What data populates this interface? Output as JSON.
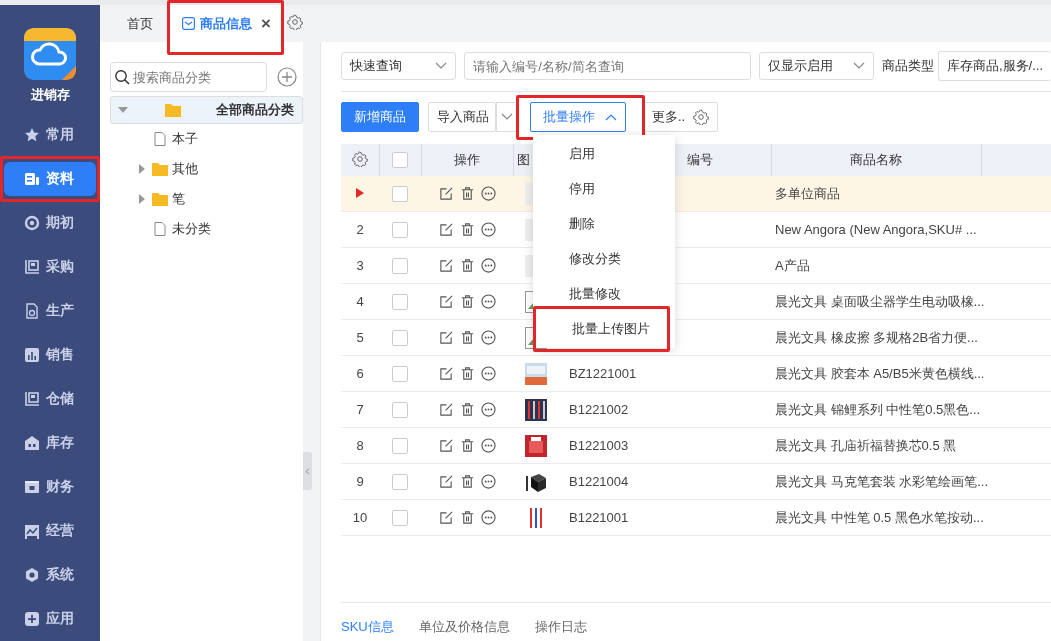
{
  "app": {
    "name": "进销存"
  },
  "nav": [
    {
      "label": "常用",
      "selected": false,
      "highlighted": false
    },
    {
      "label": "资料",
      "selected": true,
      "highlighted": true
    },
    {
      "label": "期初",
      "selected": false,
      "highlighted": false
    },
    {
      "label": "采购",
      "selected": false,
      "highlighted": false
    },
    {
      "label": "生产",
      "selected": false,
      "highlighted": false
    },
    {
      "label": "销售",
      "selected": false,
      "highlighted": false
    },
    {
      "label": "仓储",
      "selected": false,
      "highlighted": false
    },
    {
      "label": "库存",
      "selected": false,
      "highlighted": false
    },
    {
      "label": "财务",
      "selected": false,
      "highlighted": false
    },
    {
      "label": "经营",
      "selected": false,
      "highlighted": false
    },
    {
      "label": "系统",
      "selected": false,
      "highlighted": false
    },
    {
      "label": "应用",
      "selected": false,
      "highlighted": false
    }
  ],
  "tabs": [
    {
      "label": "首页",
      "selected": false,
      "closable": false,
      "highlighted": false
    },
    {
      "label": "商品信息",
      "selected": true,
      "closable": true,
      "highlighted": true
    }
  ],
  "tab_close": "×",
  "tree": {
    "search_placeholder": "搜索商品分类",
    "items": [
      {
        "label": "全部商品分类",
        "kind": "folder",
        "expanded": true,
        "selected": true,
        "children": [
          {
            "label": "本子",
            "kind": "leaf"
          },
          {
            "label": "其他",
            "kind": "folder",
            "expanded": false,
            "selected": false
          },
          {
            "label": "笔",
            "kind": "folder",
            "expanded": false,
            "selected": false
          },
          {
            "label": "未分类",
            "kind": "leaf"
          }
        ]
      }
    ]
  },
  "filters": {
    "query_mode": "快速查询",
    "search_placeholder": "请输入编号/名称/简名查询",
    "status": "仅显示启用",
    "type_label": "商品类型",
    "type_value": "库存商品,服务/..."
  },
  "toolbar": {
    "add": "新增商品",
    "import": "导入商品",
    "batch": {
      "label": "批量操作",
      "expanded": true,
      "highlighted": true
    },
    "more": "更多.."
  },
  "batch_menu": [
    {
      "label": "启用",
      "highlighted": false
    },
    {
      "label": "停用",
      "highlighted": false
    },
    {
      "label": "删除",
      "highlighted": false
    },
    {
      "label": "修改分类",
      "highlighted": false
    },
    {
      "label": "批量修改",
      "highlighted": false
    },
    {
      "label": "批量上传图片",
      "highlighted": true
    }
  ],
  "table": {
    "select_all_checked": false,
    "columns": [
      "操作",
      "图",
      "编号",
      "商品名称"
    ],
    "rows": [
      {
        "selected": true,
        "kind": "placeholder",
        "name": "多单位商品",
        "checked": false
      },
      {
        "index": "2",
        "selected": false,
        "kind": "placeholder",
        "name": "New Angora (New Angora,SKU# ...",
        "checked": false
      },
      {
        "index": "3",
        "selected": false,
        "kind": "placeholder",
        "name": "A产品",
        "checked": false
      },
      {
        "index": "4",
        "selected": false,
        "kind": "broken",
        "name": "晨光文具 桌面吸尘器学生电动吸橡...",
        "checked": false
      },
      {
        "index": "5",
        "selected": false,
        "kind": "broken",
        "name": "晨光文具 橡皮擦 多规格2B省力便...",
        "checked": false
      },
      {
        "index": "6",
        "selected": false,
        "kind": "picture",
        "code": "BZ1221001",
        "name": "晨光文具 胶套本 A5/B5米黄色横线...",
        "checked": false
      },
      {
        "index": "7",
        "selected": false,
        "kind": "picture",
        "code": "B1221002",
        "name": "晨光文具 锦鲤系列 中性笔0.5黑色...",
        "checked": false
      },
      {
        "index": "8",
        "selected": false,
        "kind": "picture",
        "code": "B1221003",
        "name": "晨光文具 孔庙祈福替换芯0.5 黑",
        "checked": false
      },
      {
        "index": "9",
        "selected": false,
        "kind": "picture",
        "code": "B1221004",
        "name": "晨光文具 马克笔套装 水彩笔绘画笔...",
        "checked": false
      },
      {
        "index": "10",
        "selected": false,
        "kind": "picture",
        "code": "B1221001",
        "name": "晨光文具 中性笔 0.5 黑色水笔按动...",
        "checked": false
      }
    ]
  },
  "bottom_tabs": [
    {
      "label": "SKU信息",
      "selected": true
    },
    {
      "label": "单位及价格信息",
      "selected": false
    },
    {
      "label": "操作日志",
      "selected": false
    }
  ]
}
